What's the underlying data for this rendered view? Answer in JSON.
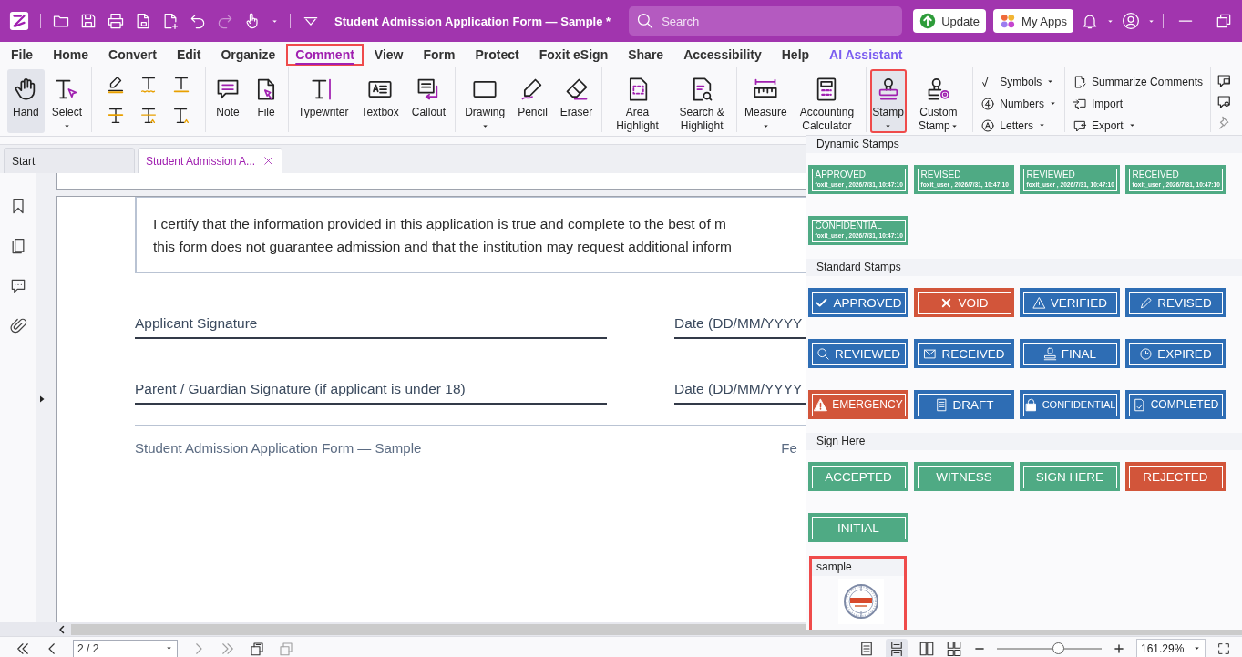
{
  "title_bar": {
    "title": "Student Admission Application Form — Sample *",
    "search": {
      "placeholder": "Search"
    },
    "buttons": [
      {
        "label": "Update",
        "kind": "update"
      },
      {
        "label": "My Apps",
        "kind": "apps"
      }
    ]
  },
  "menu_tabs": [
    {
      "label": "File",
      "kind": "tab",
      "selected": false,
      "outlined": false
    },
    {
      "label": "Home",
      "kind": "tab",
      "selected": false,
      "outlined": false
    },
    {
      "label": "Convert",
      "kind": "tab",
      "selected": false,
      "outlined": false
    },
    {
      "label": "Edit",
      "kind": "tab",
      "selected": false,
      "outlined": false
    },
    {
      "label": "Organize",
      "kind": "tab",
      "selected": false,
      "outlined": false
    },
    {
      "label": "Comment",
      "kind": "tab",
      "selected": true,
      "outlined": true
    },
    {
      "label": "View",
      "kind": "tab",
      "selected": false,
      "outlined": false
    },
    {
      "label": "Form",
      "kind": "tab",
      "selected": false,
      "outlined": false
    },
    {
      "label": "Protect",
      "kind": "tab",
      "selected": false,
      "outlined": false
    },
    {
      "label": "Foxit eSign",
      "kind": "tab",
      "selected": false,
      "outlined": false
    },
    {
      "label": "Share",
      "kind": "tab",
      "selected": false,
      "outlined": false
    },
    {
      "label": "Accessibility",
      "kind": "tab",
      "selected": false,
      "outlined": false
    },
    {
      "label": "Help",
      "kind": "tab",
      "selected": false,
      "outlined": false
    },
    {
      "label": "AI Assistant",
      "kind": "ai",
      "selected": false,
      "outlined": false
    }
  ],
  "ribbon": {
    "groups": [
      {
        "kind": "large",
        "tools": [
          {
            "label": "Hand",
            "selected": true,
            "outlined": false,
            "dropdown": false
          },
          {
            "label": "Select",
            "selected": false,
            "outlined": false,
            "dropdown": true
          }
        ]
      },
      {
        "kind": "grid",
        "tools": [
          {
            "disabled": false
          },
          {
            "disabled": false
          },
          {
            "disabled": false
          },
          {
            "disabled": false
          },
          {
            "disabled": false
          },
          {
            "disabled": false
          }
        ]
      },
      {
        "kind": "large",
        "tools": [
          {
            "label": "Note",
            "selected": false,
            "outlined": false,
            "dropdown": false
          },
          {
            "label": "File",
            "selected": false,
            "outlined": false,
            "dropdown": false
          }
        ]
      },
      {
        "kind": "large",
        "tools": [
          {
            "label": "Typewriter",
            "selected": false,
            "outlined": false,
            "dropdown": false
          },
          {
            "label": "Textbox",
            "selected": false,
            "outlined": false,
            "dropdown": false
          },
          {
            "label": "Callout",
            "selected": false,
            "outlined": false,
            "dropdown": false
          }
        ]
      },
      {
        "kind": "large",
        "tools": [
          {
            "label": "Drawing",
            "selected": false,
            "outlined": false,
            "dropdown": true
          },
          {
            "label": "Pencil",
            "selected": false,
            "outlined": false,
            "dropdown": false
          },
          {
            "label": "Eraser",
            "selected": false,
            "outlined": false,
            "dropdown": false
          }
        ]
      },
      {
        "kind": "large",
        "tools": [
          {
            "label": "Area Highlight",
            "selected": false,
            "outlined": false,
            "dropdown": false
          },
          {
            "label": "Search & Highlight",
            "selected": false,
            "outlined": false,
            "dropdown": false
          }
        ]
      },
      {
        "kind": "large",
        "tools": [
          {
            "label": "Measure",
            "selected": false,
            "outlined": false,
            "dropdown": true
          },
          {
            "label": "Accounting Calculator",
            "selected": false,
            "outlined": false,
            "dropdown": false
          }
        ]
      },
      {
        "kind": "large",
        "tools": [
          {
            "label": "Stamp",
            "selected": true,
            "outlined": true,
            "dropdown": true
          },
          {
            "label": "Custom Stamp",
            "selected": false,
            "outlined": false,
            "dropdown": true
          }
        ]
      },
      {
        "kind": "list",
        "tools": [
          {
            "label": "Symbols",
            "dropdown": true
          },
          {
            "label": "Numbers",
            "dropdown": true
          },
          {
            "label": "Letters",
            "dropdown": true
          }
        ]
      },
      {
        "kind": "list",
        "tools": [
          {
            "label": "Summarize Comments",
            "dropdown": false
          },
          {
            "label": "Import",
            "dropdown": false
          },
          {
            "label": "Export",
            "dropdown": true
          }
        ]
      },
      {
        "kind": "icon_column",
        "tools": [
          {
            "disabled": false
          },
          {
            "disabled": false
          },
          {
            "disabled": true
          }
        ]
      }
    ]
  },
  "doc_tabs": [
    {
      "label": "Start",
      "selected": false,
      "closable": false
    },
    {
      "label": "Student Admission A...",
      "selected": true,
      "closable": true
    }
  ],
  "document": {
    "certification": [
      "I certify that the information provided in this application is true and complete to the best of m",
      "this form does not guarantee admission and that the institution may request additional inform"
    ],
    "signatures": [
      {
        "label": "Applicant Signature",
        "date": "Date (DD/MM/YYYY"
      },
      {
        "label": "Parent / Guardian Signature (if applicant is under 18)",
        "date": "Date (DD/MM/YYYY"
      }
    ],
    "footer": {
      "left": "Student Admission Application Form — Sample",
      "right": "Fe"
    }
  },
  "stamp_panel": {
    "sections": [
      {
        "title": "Dynamic Stamps",
        "outlined": false,
        "stamps": [
          {
            "kind": "dynamic",
            "label": "APPROVED",
            "detail": "foxit_user , 2026/7/31, 10:47:10",
            "color": "#4faa84"
          },
          {
            "kind": "dynamic",
            "label": "REVISED",
            "detail": "foxit_user , 2026/7/31, 10:47:10",
            "color": "#4faa84"
          },
          {
            "kind": "dynamic",
            "label": "REVIEWED",
            "detail": "foxit_user , 2026/7/31, 10:47:10",
            "color": "#4faa84"
          },
          {
            "kind": "dynamic",
            "label": "RECEIVED",
            "detail": "foxit_user , 2026/7/31, 10:47:10",
            "color": "#4faa84"
          },
          {
            "kind": "dynamic",
            "label": "CONFIDENTIAL",
            "detail": "foxit_user , 2026/7/31, 10:47:10",
            "color": "#4faa84"
          }
        ]
      },
      {
        "title": "Standard Stamps",
        "outlined": false,
        "stamps": [
          {
            "kind": "standard",
            "label": "APPROVED",
            "color": "#2e6db4"
          },
          {
            "kind": "standard",
            "label": "VOID",
            "color": "#d2553a"
          },
          {
            "kind": "standard",
            "label": "VERIFIED",
            "color": "#2e6db4"
          },
          {
            "kind": "standard",
            "label": "REVISED",
            "color": "#2e6db4"
          },
          {
            "kind": "standard",
            "label": "REVIEWED",
            "color": "#2e6db4"
          },
          {
            "kind": "standard",
            "label": "RECEIVED",
            "color": "#2e6db4"
          },
          {
            "kind": "standard",
            "label": "FINAL",
            "color": "#2e6db4"
          },
          {
            "kind": "standard",
            "label": "EXPIRED",
            "color": "#2e6db4"
          },
          {
            "kind": "standard",
            "label": "EMERGENCY",
            "color": "#d2553a"
          },
          {
            "kind": "standard",
            "label": "DRAFT",
            "color": "#2e6db4"
          },
          {
            "kind": "standard",
            "label": "CONFIDENTIAL",
            "color": "#2e6db4"
          },
          {
            "kind": "standard",
            "label": "COMPLETED",
            "color": "#2e6db4"
          }
        ]
      },
      {
        "title": "Sign Here",
        "outlined": false,
        "stamps": [
          {
            "kind": "plain",
            "label": "ACCEPTED",
            "color": "#4faa84"
          },
          {
            "kind": "plain",
            "label": "WITNESS",
            "color": "#4faa84"
          },
          {
            "kind": "plain",
            "label": "SIGN HERE",
            "color": "#4faa84"
          },
          {
            "kind": "plain",
            "label": "REJECTED",
            "color": "#d2553a"
          },
          {
            "kind": "plain",
            "label": "INITIAL",
            "color": "#4faa84"
          }
        ]
      },
      {
        "title": "sample",
        "outlined": true
      }
    ]
  },
  "status_bar": {
    "page": "2 / 2",
    "zoom": "161.29%",
    "zoom_slider": {
      "level": 0.58
    }
  }
}
